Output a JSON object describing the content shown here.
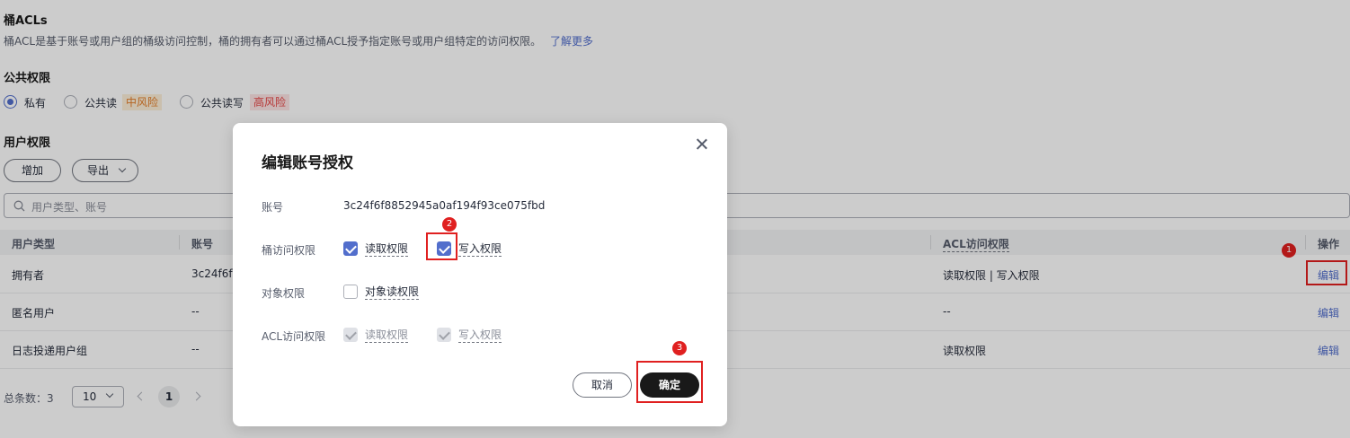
{
  "bucket_acl": {
    "title": "桶ACLs",
    "description": "桶ACL是基于账号或用户组的桶级访问控制，桶的拥有者可以通过桶ACL授予指定账号或用户组特定的访问权限。",
    "learn_more": "了解更多"
  },
  "public_permission": {
    "title": "公共权限",
    "options": [
      {
        "label": "私有",
        "checked": true
      },
      {
        "label": "公共读",
        "tag": "中风险",
        "checked": false
      },
      {
        "label": "公共读写",
        "tag": "高风险",
        "checked": false
      }
    ]
  },
  "user_permission": {
    "title": "用户权限",
    "add_label": "增加",
    "export_label": "导出",
    "search_placeholder": "用户类型、账号"
  },
  "table": {
    "headers": {
      "user_type": "用户类型",
      "account": "账号",
      "acl_access": "ACL访问权限",
      "actions": "操作"
    },
    "rows": [
      {
        "user_type": "拥有者",
        "account": "3c24f6f",
        "acl": "读取权限 | 写入权限",
        "action": "编辑"
      },
      {
        "user_type": "匿名用户",
        "account": "--",
        "acl": "--",
        "action": "编辑"
      },
      {
        "user_type": "日志投递用户组",
        "account": "--",
        "acl": "读取权限",
        "action": "编辑"
      }
    ]
  },
  "pagination": {
    "total_label": "总条数：3",
    "page_size": "10",
    "current_page": "1"
  },
  "dialog": {
    "title": "编辑账号授权",
    "account_label": "账号",
    "account_value": "3c24f6f8852945a0af194f93ce075fbd",
    "bucket_access_label": "桶访问权限",
    "bucket_read": {
      "label": "读取权限",
      "checked": true
    },
    "bucket_write": {
      "label": "写入权限",
      "checked": true
    },
    "object_label": "对象权限",
    "object_read": {
      "label": "对象读权限",
      "checked": false
    },
    "acl_label": "ACL访问权限",
    "acl_read": {
      "label": "读取权限",
      "checked": true,
      "disabled": true
    },
    "acl_write": {
      "label": "写入权限",
      "checked": true,
      "disabled": true
    },
    "cancel_label": "取消",
    "ok_label": "确定"
  },
  "annotations": {
    "step1": "1",
    "step2": "2",
    "step3": "3"
  },
  "colors": {
    "accent": "#526ecc",
    "highlight": "#e02020",
    "primary_button": "#191919"
  }
}
